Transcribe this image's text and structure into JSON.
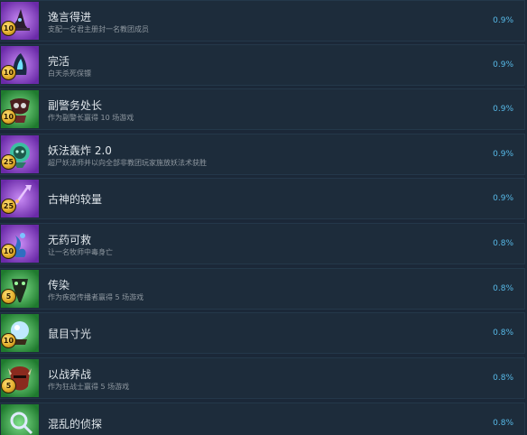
{
  "achievements": [
    {
      "title": "逸言得进",
      "desc": "支配一名君主册封一名教团成员",
      "percent": "0.9%",
      "badge": "10",
      "icon": "witch-hat-icon",
      "bg": "#8a3fc9"
    },
    {
      "title": "完活",
      "desc": "白天杀死保镖",
      "percent": "0.9%",
      "badge": "10",
      "icon": "ghost-wisp-icon",
      "bg": "#8a3fc9"
    },
    {
      "title": "副警务处长",
      "desc": "作为副警长赢得 10 场游戏",
      "percent": "0.9%",
      "badge": "10",
      "icon": "sheriff-mask-icon",
      "bg": "#2f9a3c"
    },
    {
      "title": "妖法轰炸 2.0",
      "desc": "超尸妖法师并以向全部非教团玩家施放妖法术获胜",
      "percent": "0.9%",
      "badge": "25",
      "icon": "hex-skull-icon",
      "bg": "#8a3fc9"
    },
    {
      "title": "古神的较量",
      "desc": "",
      "percent": "0.9%",
      "badge": "25",
      "icon": "trident-staff-icon",
      "bg": "#8a3fc9"
    },
    {
      "title": "无药可救",
      "desc": "让一名牧师中毒身亡",
      "percent": "0.8%",
      "badge": "10",
      "icon": "poison-vine-icon",
      "bg": "#8a3fc9"
    },
    {
      "title": "传染",
      "desc": "作为疾疫传播者赢得 5 场游戏",
      "percent": "0.8%",
      "badge": "5",
      "icon": "plague-doctor-icon",
      "bg": "#2f9a3c"
    },
    {
      "title": "鼠目寸光",
      "desc": "",
      "percent": "0.8%",
      "badge": "10",
      "icon": "crystal-ball-icon",
      "bg": "#2f9a3c"
    },
    {
      "title": "以战养战",
      "desc": "作为狂战士赢得 5 场游戏",
      "percent": "0.8%",
      "badge": "5",
      "icon": "berserker-helm-icon",
      "bg": "#2f9a3c"
    },
    {
      "title": "混乱的侦探",
      "desc": "",
      "percent": "0.8%",
      "badge": "",
      "icon": "magnifier-potion-icon",
      "bg": "#2f9a3c"
    }
  ]
}
